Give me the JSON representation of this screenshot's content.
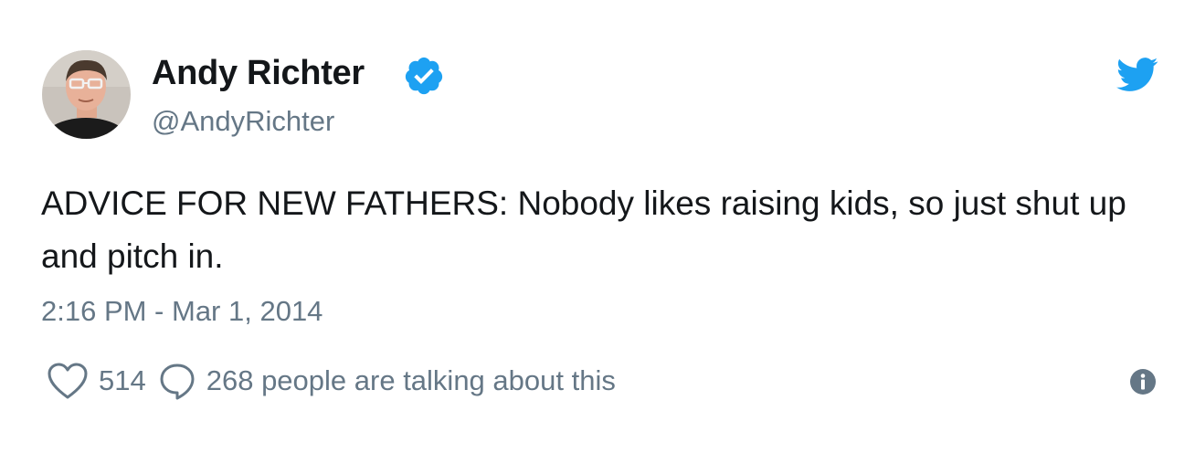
{
  "author": {
    "name": "Andy Richter",
    "handle": "@AndyRichter",
    "verified": true,
    "avatar": "avatar-photo"
  },
  "tweet": {
    "text": "ADVICE FOR NEW FATHERS: Nobody likes raising kids, so just shut up and pitch in.",
    "timestamp": "2:16 PM - Mar 1, 2014"
  },
  "actions": {
    "likes": "514",
    "talking": "268 people are talking about this"
  },
  "icons": {
    "brand": "twitter-bird-icon",
    "verified": "verified-badge-icon",
    "like": "heart-icon",
    "reply": "speech-bubble-icon",
    "info": "info-icon"
  },
  "colors": {
    "twitter_blue": "#1DA1F2",
    "text_primary": "#14171a",
    "text_secondary": "#657786"
  }
}
